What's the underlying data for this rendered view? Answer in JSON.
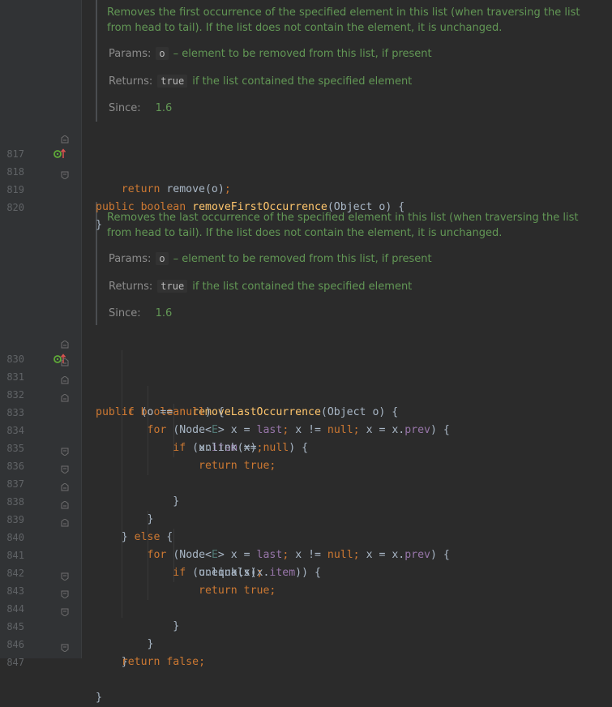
{
  "doc1": {
    "description": "Removes the first occurrence of the specified element in this list (when traversing the list from head to tail). If the list does not contain the element, it is unchanged.",
    "params_label": "Params:",
    "param_name": "o",
    "param_desc": "– element to be removed from this list, if present",
    "returns_label": "Returns:",
    "returns_code": "true",
    "returns_desc": "if the list contained the specified element",
    "since_label": "Since:",
    "since_value": "1.6"
  },
  "doc2": {
    "description": "Removes the last occurrence of the specified element in this list (when traversing the list from head to tail). If the list does not contain the element, it is unchanged.",
    "params_label": "Params:",
    "param_name": "o",
    "param_desc": "– element to be removed from this list, if present",
    "returns_label": "Returns:",
    "returns_code": "true",
    "returns_desc": "if the list contained the specified element",
    "since_label": "Since:",
    "since_value": "1.6"
  },
  "line_numbers": [
    "817",
    "818",
    "819",
    "820",
    "830",
    "831",
    "832",
    "833",
    "834",
    "835",
    "836",
    "837",
    "838",
    "839",
    "840",
    "841",
    "842",
    "843",
    "844",
    "845",
    "846",
    "847"
  ],
  "code": {
    "kw_public": "public",
    "kw_boolean": "boolean",
    "m1_name": "removeFirstOccurrence",
    "m2_name": "removeLastOccurrence",
    "param_list": "(Object o) {",
    "kw_return": "return",
    "remove_call": "remove(o)",
    "semi": ";",
    "close_brace": "}",
    "kw_if": "if",
    "if_null_cond": "(o == ",
    "kw_null": "null",
    "paren_open_brace": ") {",
    "kw_for": "for",
    "node_open": "(Node<",
    "type_e": "E",
    "node_close": "> x = ",
    "fld_last": "last",
    "x_ne": " x != ",
    "x_eq": " x = x.",
    "fld_prev": "prev",
    "x_dot": "(x.",
    "fld_item": "item",
    "eq_eq": " == ",
    "unlink_call": "unlink(x)",
    "kw_true": "true",
    "kw_else": "else",
    "brace_sp": "} ",
    "sp_brace": " {",
    "equals_call": "(o.equals(x.",
    "dbl_paren_brace": ")) {",
    "kw_false": "false"
  },
  "colors": {
    "background": "#2b2b2b",
    "gutter": "#313335",
    "keyword": "#cc7832",
    "method": "#ffc66d",
    "field": "#9876aa",
    "doc": "#629755",
    "text": "#a9b7c6",
    "override_icon": "#5faa38",
    "arrow_icon": "#d9534f"
  },
  "icons": [
    "override-up-icon",
    "fold-icon"
  ]
}
